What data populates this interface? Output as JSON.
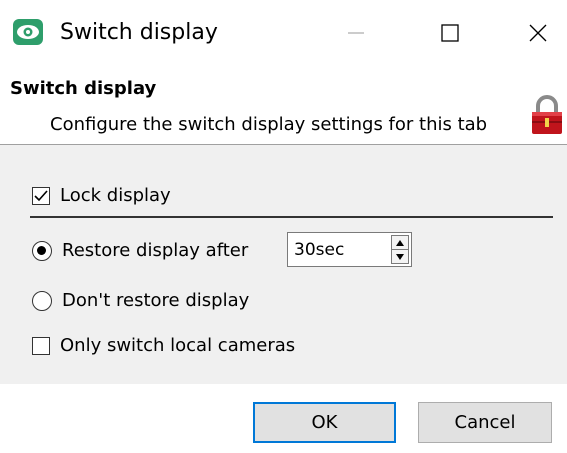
{
  "window": {
    "title": "Switch display",
    "icon": "eye-icon",
    "controls": [
      "minimize-icon",
      "maximize-icon",
      "close-icon"
    ]
  },
  "header": {
    "title": "Switch display",
    "description": "Configure the switch display settings for this tab",
    "icon": "padlock-icon"
  },
  "options": {
    "lock_display": {
      "label": "Lock display",
      "checked": true
    },
    "restore_after": {
      "label": "Restore display after",
      "selected": true,
      "value": "30sec"
    },
    "dont_restore": {
      "label": "Don't restore display",
      "selected": false
    },
    "only_local": {
      "label": "Only switch local cameras",
      "checked": false
    }
  },
  "buttons": {
    "ok": "OK",
    "cancel": "Cancel"
  },
  "colors": {
    "accent": "#0078d7",
    "icon_green": "#2e9e6b",
    "lock_red": "#c0141c"
  }
}
